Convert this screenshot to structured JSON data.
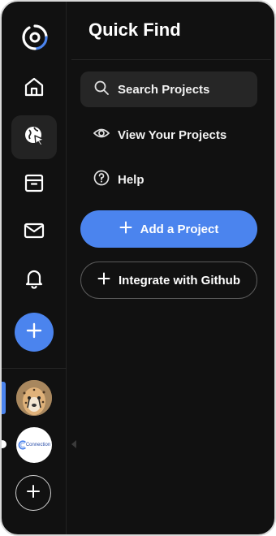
{
  "sidebar": {
    "logo_icon": "swirl-logo-icon",
    "nav_items": [
      {
        "icon": "home-icon",
        "active": false
      },
      {
        "icon": "globe-cursor-icon",
        "active": true
      },
      {
        "icon": "archive-icon",
        "active": false
      },
      {
        "icon": "mail-icon",
        "active": false
      },
      {
        "icon": "bell-icon",
        "active": false
      }
    ],
    "create_button_icon": "plus-icon",
    "workspaces": [
      {
        "name": "cheetah-avatar",
        "selected": true
      },
      {
        "name": "connection-avatar",
        "label": "Connection",
        "selected": false
      }
    ],
    "add_workspace_icon": "plus-icon"
  },
  "panel": {
    "title": "Quick Find",
    "items": [
      {
        "label": "Search Projects",
        "icon": "search-icon"
      },
      {
        "label": "View Your Projects",
        "icon": "eye-icon"
      },
      {
        "label": "Help",
        "icon": "help-circle-icon"
      }
    ],
    "primary_button": {
      "label": "Add a Project",
      "icon": "plus-icon"
    },
    "secondary_button": {
      "label": "Integrate with Github",
      "icon": "plus-icon"
    }
  },
  "colors": {
    "background": "#111111",
    "accent": "#4b84ee",
    "surface": "#262626",
    "text": "#ffffff"
  }
}
